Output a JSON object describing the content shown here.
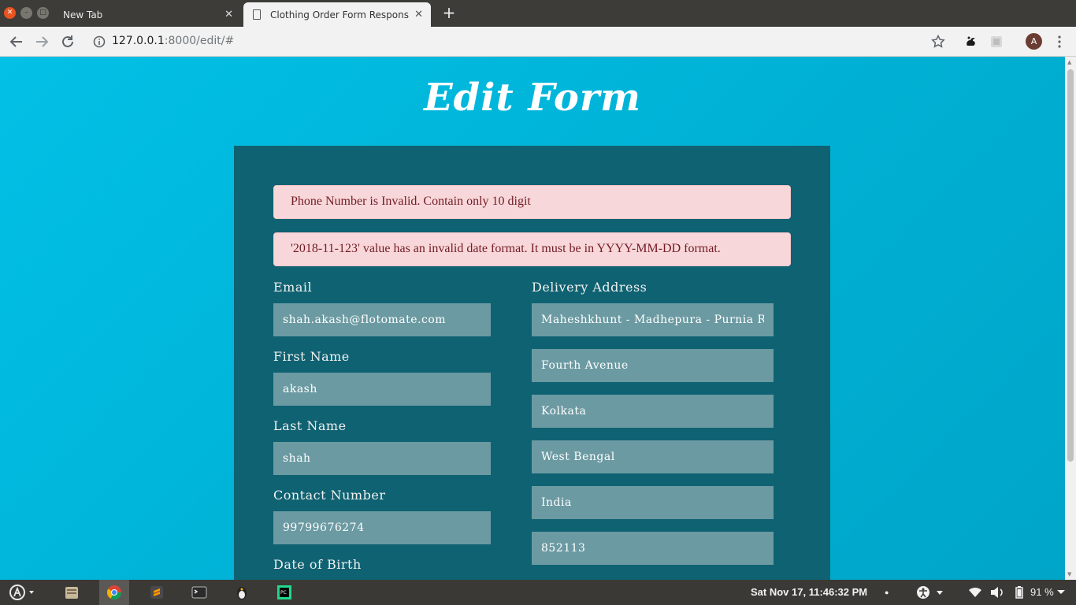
{
  "browser": {
    "tabs": [
      {
        "title": "New Tab",
        "active": false
      },
      {
        "title": "Clothing Order Form Responsive",
        "active": true
      }
    ],
    "close_glyph": "✕",
    "new_tab_glyph": "+",
    "url_host": "127.0.0.1",
    "url_path": ":8000/edit/#",
    "profile_initial": "A"
  },
  "page": {
    "title": "Edit Form",
    "errors": [
      "Phone Number is Invalid. Contain only 10 digit",
      "'2018-11-123' value has an invalid date format. It must be in YYYY-MM-DD format."
    ],
    "labels": {
      "email": "Email",
      "first_name": "First Name",
      "last_name": "Last Name",
      "contact": "Contact Number",
      "dob": "Date of Birth",
      "delivery_address": "Delivery Address"
    },
    "values": {
      "email": "shah.akash@flotomate.com",
      "first_name": "akash",
      "last_name": "shah",
      "contact": "99799676274",
      "address_line1": "Maheshkhunt - Madhepura - Purnia Road",
      "address_line2": "Fourth Avenue",
      "city": "Kolkata",
      "state": "West Bengal",
      "country": "India",
      "pincode": "852113"
    }
  },
  "system": {
    "clock": "Sat Nov 17, 11:46:32 PM",
    "battery": "91 %"
  },
  "colors": {
    "page_bg": "#00b2d6",
    "card_bg": "#0f6272",
    "field_bg": "#6b9aa2",
    "alert_bg": "#f8d7da",
    "alert_text": "#721c24"
  }
}
